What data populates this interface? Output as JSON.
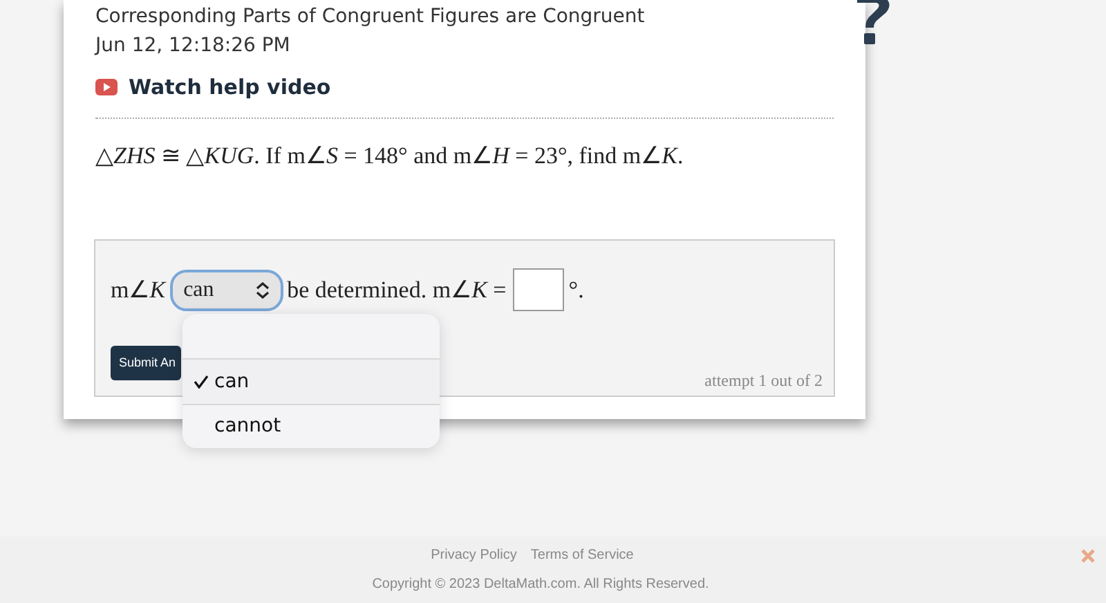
{
  "header": {
    "title": "Corresponding Parts of Congruent Figures are Congruent",
    "timestamp": "Jun 12, 12:18:26 PM",
    "help_link": "Watch help video"
  },
  "question": "△*ZHS* ≅ △*KUG*. If m∠*S* = 148° and m∠*H* = 23°, find m∠*K*.",
  "answer": {
    "prefix": "m∠*K*",
    "select_value": "can",
    "middle": "be determined. m∠*K* =",
    "suffix": "°.",
    "submit": "Submit An",
    "attempt": "attempt 1 out of 2",
    "options": [
      {
        "label": "can",
        "selected": true
      },
      {
        "label": "cannot",
        "selected": false
      }
    ]
  },
  "footer": {
    "links": [
      "Privacy Policy",
      "Terms of Service"
    ],
    "copyright": "Copyright © 2023 DeltaMath.com. All Rights Reserved."
  }
}
